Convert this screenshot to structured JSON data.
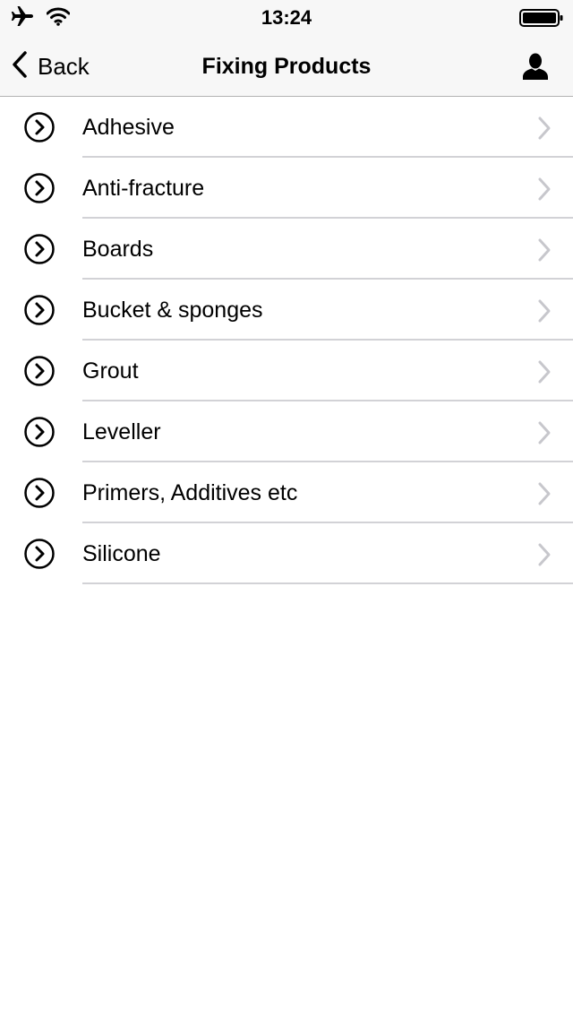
{
  "status_bar": {
    "time": "13:24",
    "icons": [
      "airplane-icon",
      "wifi-icon",
      "battery-icon"
    ]
  },
  "nav": {
    "back_label": "Back",
    "title": "Fixing Products",
    "back_icon": "chevron-left-icon",
    "profile_icon": "person-icon"
  },
  "list": {
    "items": [
      {
        "label": "Adhesive"
      },
      {
        "label": "Anti-fracture"
      },
      {
        "label": "Boards"
      },
      {
        "label": "Bucket & sponges"
      },
      {
        "label": "Grout"
      },
      {
        "label": "Leveller"
      },
      {
        "label": "Primers, Additives etc"
      },
      {
        "label": "Silicone"
      }
    ],
    "leading_icon": "circle-chevron-right-icon",
    "trailing_icon": "chevron-right-icon"
  },
  "colors": {
    "bar_background": "#f7f7f7",
    "separator": "#d2d2d6",
    "chevron": "#c7c7cc",
    "text": "#000000"
  }
}
